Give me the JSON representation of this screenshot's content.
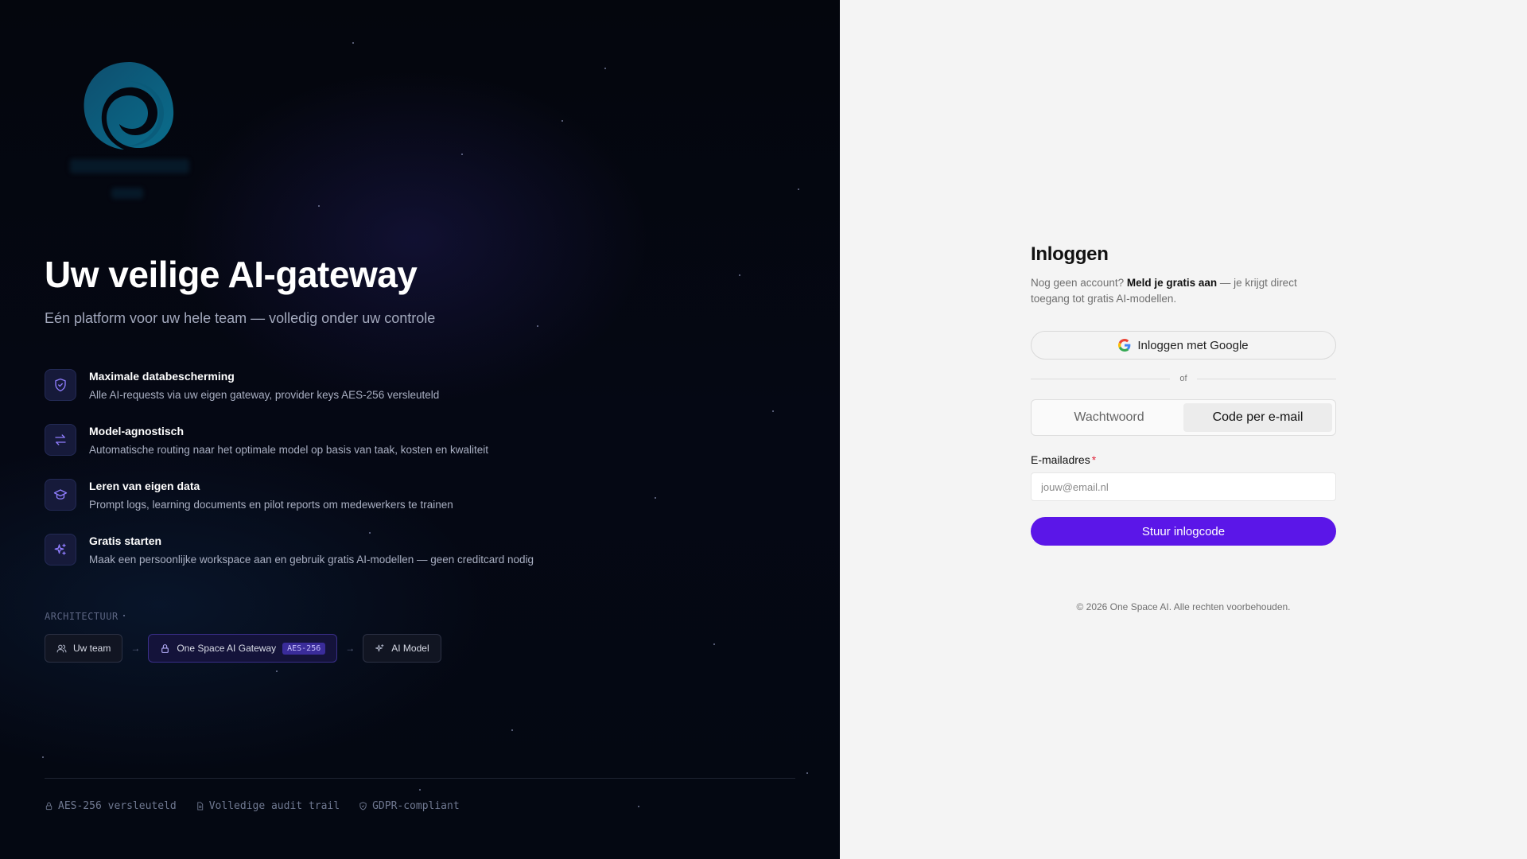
{
  "left": {
    "hero_title": "Uw veilige AI-gateway",
    "hero_subtitle": "Eén platform voor uw hele team — volledig onder uw controle",
    "features": [
      {
        "icon": "shield-icon",
        "title": "Maximale databescherming",
        "desc": "Alle AI-requests via uw eigen gateway, provider keys AES-256 versleuteld"
      },
      {
        "icon": "swap-arrows-icon",
        "title": "Model-agnostisch",
        "desc": "Automatische routing naar het optimale model op basis van taak, kosten en kwaliteit"
      },
      {
        "icon": "graduation-cap-icon",
        "title": "Leren van eigen data",
        "desc": "Prompt logs, learning documents en pilot reports om medewerkers te trainen"
      },
      {
        "icon": "sparkles-icon",
        "title": "Gratis starten",
        "desc": "Maak een persoonlijke workspace aan en gebruik gratis AI-modellen — geen creditcard nodig"
      }
    ],
    "architecture": {
      "label": "ARCHITECTUUR",
      "team": "Uw team",
      "gateway": "One Space AI Gateway",
      "gateway_badge": "AES-256",
      "model": "AI Model",
      "arrow": "→"
    },
    "footer": {
      "item1": "AES-256 versleuteld",
      "item2": "Volledige audit trail",
      "item3": "GDPR-compliant"
    },
    "colors": {
      "accent": "#5b16e8",
      "icon_bg": "#161a3a"
    }
  },
  "right": {
    "title": "Inloggen",
    "sub_prefix": "Nog geen account?",
    "sub_link": "Meld je gratis aan",
    "sub_suffix": "— je krijgt direct toegang tot gratis AI-modellen.",
    "google_button": "Inloggen met Google",
    "or_text": "of",
    "tabs": [
      "Wachtwoord",
      "Code per e-mail"
    ],
    "active_tab": "Code per e-mail",
    "email_label": "E-mailadres",
    "email_required": "*",
    "email_placeholder": "jouw@email.nl",
    "email_value": "",
    "submit_button": "Stuur inlogcode",
    "copyright": "© 2026 One Space AI. Alle rechten voorbehouden."
  }
}
